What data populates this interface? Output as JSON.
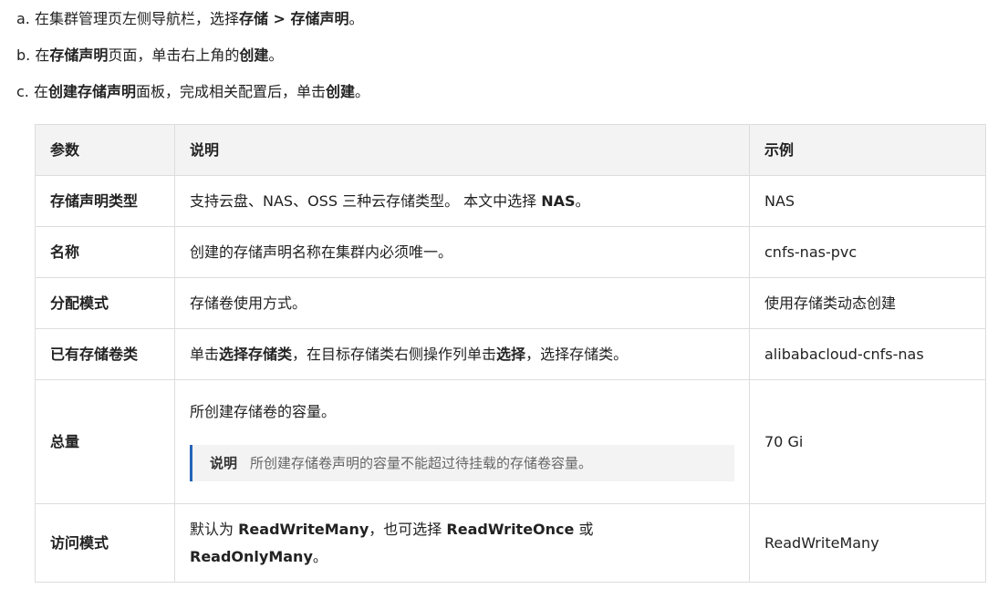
{
  "steps": [
    {
      "prefix": "a. 在集群管理页左侧导航栏，选择",
      "b1": "存储 > 存储声明",
      "suffix": "。"
    },
    {
      "prefix": "b. 在",
      "b1": "存储声明",
      "mid": "页面，单击右上角的",
      "b2": "创建",
      "suffix": "。"
    },
    {
      "prefix": "c. 在",
      "b1": "创建存储声明",
      "mid": "面板，完成相关配置后，单击",
      "b2": "创建",
      "suffix": "。"
    }
  ],
  "table": {
    "headers": [
      "参数",
      "说明",
      "示例"
    ],
    "rows": [
      {
        "name": "存储声明类型",
        "desc_pre": "支持云盘、NAS、OSS 三种云存储类型。 本文中选择 ",
        "desc_b1": "NAS",
        "desc_post": "。",
        "example": "NAS"
      },
      {
        "name": "名称",
        "desc_pre": "创建的存储声明名称在集群内必须唯一。",
        "example": "cnfs-nas-pvc"
      },
      {
        "name": "分配模式",
        "desc_pre": "存储卷使用方式。",
        "example": "使用存储类动态创建"
      },
      {
        "name": "已有存储卷类",
        "desc_pre": "单击",
        "desc_b1": "选择存储类",
        "desc_mid": "，在目标存储类右侧操作列单击",
        "desc_b2": "选择",
        "desc_post": "，选择存储类。",
        "example": "alibabacloud-cnfs-nas"
      },
      {
        "name": "总量",
        "desc_pre": "所创建存储卷的容量。",
        "note_label": "说明",
        "note_text": "所创建存储卷声明的容量不能超过待挂载的存储卷容量。",
        "example": "70 Gi"
      },
      {
        "name": "访问模式",
        "desc_pre": "默认为 ",
        "desc_b1": "ReadWriteMany",
        "desc_mid": "，也可选择 ",
        "desc_b2": "ReadWriteOnce",
        "desc_mid2": " 或",
        "desc_b3": "ReadOnlyMany",
        "desc_post": "。",
        "example": "ReadWriteMany"
      }
    ]
  }
}
